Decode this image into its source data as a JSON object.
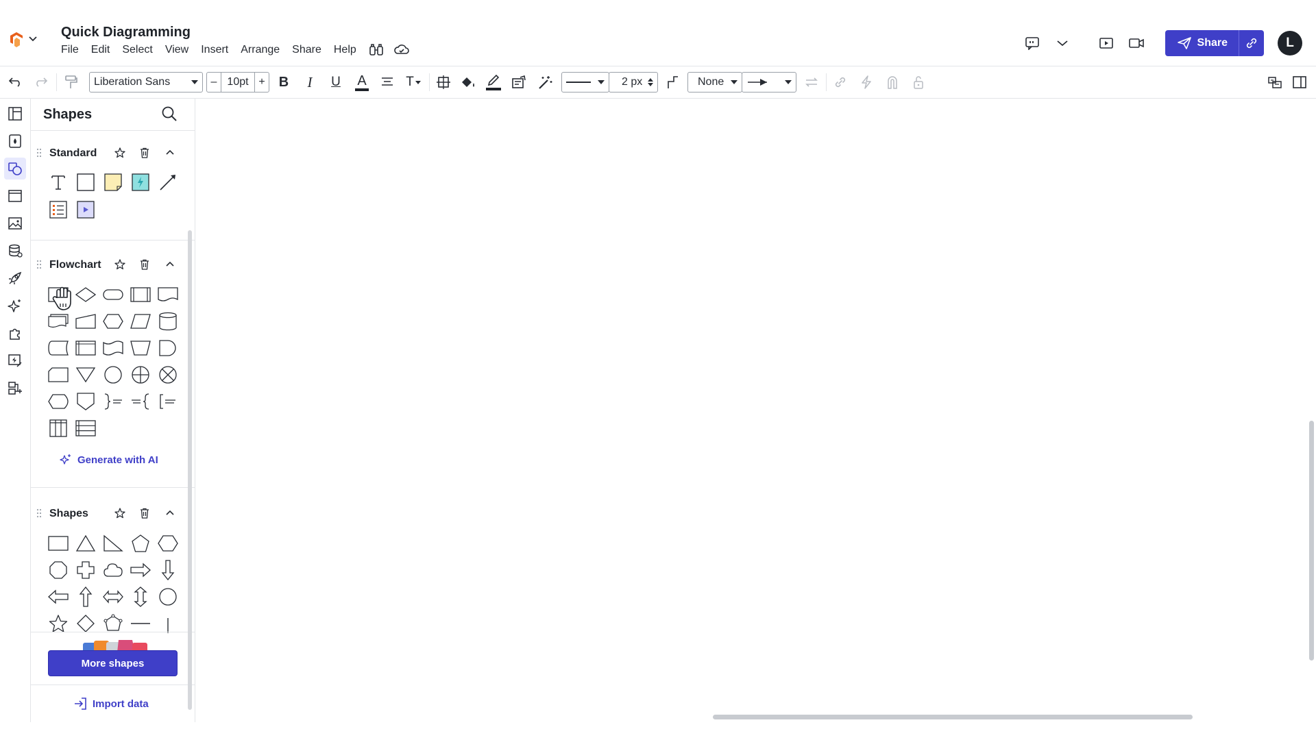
{
  "app": {
    "doc_title": "Quick Diagramming",
    "brand_color": "#e8601c",
    "accent_color": "#3f3fc8"
  },
  "menubar": [
    "File",
    "Edit",
    "Select",
    "View",
    "Insert",
    "Arrange",
    "Share",
    "Help"
  ],
  "header_right": {
    "share_label": "Share",
    "avatar_initial": "L",
    "icons": [
      "comment-icon",
      "chevron-down-icon",
      "present-icon",
      "video-icon",
      "link-icon"
    ]
  },
  "toolbar": {
    "font_family": "Liberation Sans",
    "font_size": "10pt",
    "minus": "–",
    "plus": "+",
    "line_width": "2 px",
    "line_start": "None"
  },
  "panel": {
    "title": "Shapes",
    "libraries": [
      {
        "name": "Standard"
      },
      {
        "name": "Flowchart"
      },
      {
        "name": "Shapes"
      }
    ],
    "generate_ai_label": "Generate with AI",
    "more_shapes_label": "More shapes",
    "import_data_label": "Import data"
  },
  "icons": {
    "undo": "undo-icon",
    "redo": "redo-icon",
    "format_painter": "format-painter-icon",
    "bold": "B",
    "italic": "I",
    "underline": "U",
    "font_color": "A",
    "text_options": "T"
  }
}
